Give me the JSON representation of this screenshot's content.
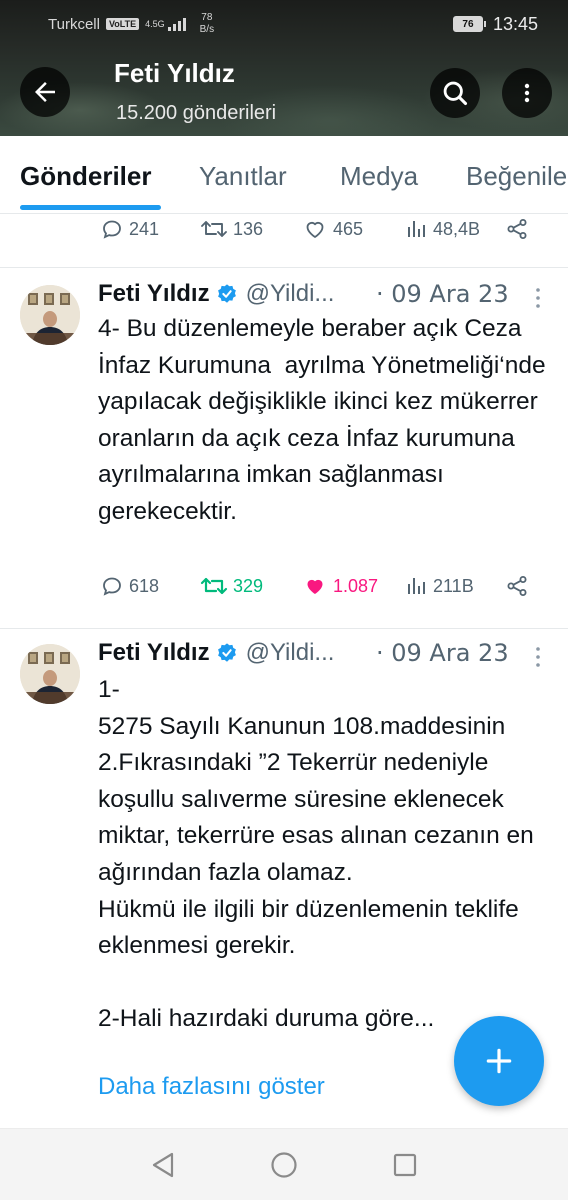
{
  "status_bar": {
    "carrier": "Turkcell",
    "volte": "VoLTE",
    "network": "4.5G",
    "speed_value": "78",
    "speed_unit": "B/s",
    "battery": "76",
    "time": "13:45"
  },
  "header": {
    "name": "Feti Yıldız",
    "posts_count": "15.200 gönderileri"
  },
  "tabs": [
    {
      "label": "Gönderiler",
      "active": true
    },
    {
      "label": "Yanıtlar",
      "active": false
    },
    {
      "label": "Medya",
      "active": false
    },
    {
      "label": "Beğeniler",
      "active": false
    }
  ],
  "prev_tweet_stats": {
    "replies": "241",
    "retweets": "136",
    "likes": "465",
    "views": "48,4B"
  },
  "tweets": [
    {
      "name": "Feti Yıldız",
      "handle": "@Yildi...",
      "date": "· 09 Ara 23",
      "text": "4- Bu düzenlemeyle beraber açık Ceza İnfaz Kurumuna  ayrılma Yönetmeliği‘nde yapılacak değişiklikle ikinci kez mükerrer oranların da açık ceza İnfaz kurumuna ayrılmalarına imkan sağlanması gerekecektir.",
      "replies": "618",
      "retweets": "329",
      "likes": "1.087",
      "views": "211B"
    },
    {
      "name": "Feti Yıldız",
      "handle": "@Yildi...",
      "date": "· 09 Ara 23",
      "text": "1-\n5275 Sayılı Kanunun 108.maddesinin 2.Fıkrasındaki ”2 Tekerrür nedeniyle koşullu salıverme süresine eklenecek miktar, tekerrüre esas alınan cezanın en ağırından fazla olamaz.\nHükmü ile ilgili bir düzenlemenin teklife eklenmesi gerekir.\n\n2-Hali hazırdaki duruma göre...",
      "show_more": "Daha fazlasını göster"
    }
  ],
  "colors": {
    "accent": "#1d9bf0",
    "retweet_green": "#00ba7c",
    "like_pink": "#f91880",
    "muted": "#536471"
  }
}
